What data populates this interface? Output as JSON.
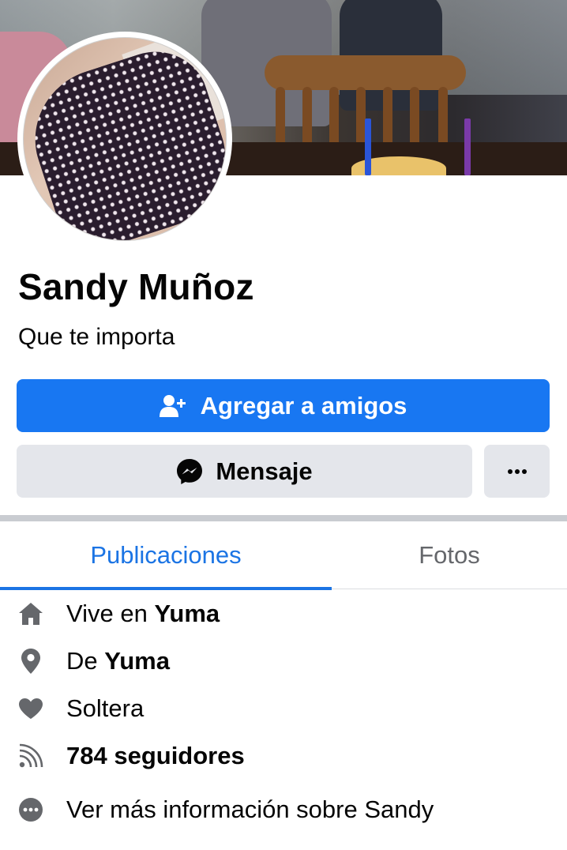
{
  "profile": {
    "name": "Sandy Muñoz",
    "bio": "Que te importa"
  },
  "actions": {
    "add_friend_label": "Agregar a amigos",
    "message_label": "Mensaje",
    "more_label": "···"
  },
  "tabs": [
    {
      "label": "Publicaciones",
      "selected": true
    },
    {
      "label": "Fotos",
      "selected": false
    }
  ],
  "details": {
    "lives_prefix": "Vive en ",
    "lives_city": "Yuma",
    "from_prefix": "De ",
    "from_city": "Yuma",
    "relationship": "Soltera",
    "followers": "784 seguidores",
    "see_more": "Ver más información sobre Sandy"
  },
  "icons": {
    "add_friend": "add-person-icon",
    "message": "messenger-icon",
    "more": "more-dots-icon",
    "lives": "home-icon",
    "from": "location-pin-icon",
    "relationship": "heart-icon",
    "followers": "rss-icon",
    "see_more": "more-circle-icon"
  },
  "colors": {
    "accent": "#1877f2",
    "tab_active": "#1b74e4",
    "tab_inactive": "#65676b",
    "secondary_button": "#e4e6eb",
    "icon_gray": "#65676b"
  }
}
